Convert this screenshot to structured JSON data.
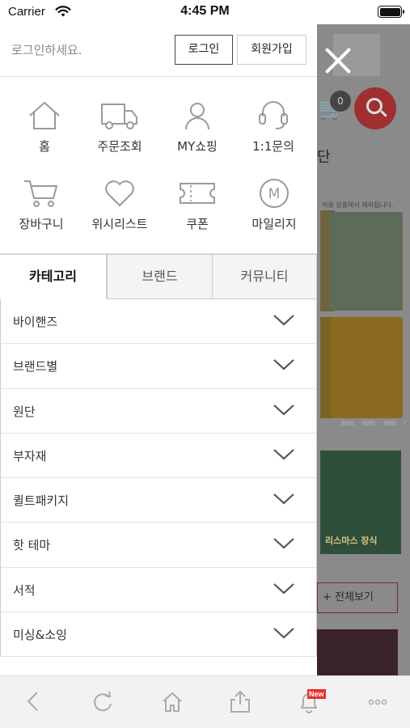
{
  "status_bar": {
    "carrier": "Carrier",
    "time": "4:45 PM"
  },
  "drawer": {
    "login_prompt": "로그인하세요.",
    "login_button": "로그인",
    "signup_button": "회원가입",
    "quick_links": [
      {
        "label": "홈",
        "icon": "home-icon"
      },
      {
        "label": "주문조회",
        "icon": "truck-icon"
      },
      {
        "label": "MY쇼핑",
        "icon": "person-icon"
      },
      {
        "label": "1:1문의",
        "icon": "headset-icon"
      },
      {
        "label": "장바구니",
        "icon": "cart-icon"
      },
      {
        "label": "위시리스트",
        "icon": "heart-icon"
      },
      {
        "label": "쿠폰",
        "icon": "coupon-icon"
      },
      {
        "label": "마일리지",
        "icon": "mileage-icon"
      }
    ],
    "mileage_icon_letter": "M",
    "tabs": [
      {
        "label": "카테고리",
        "active": true
      },
      {
        "label": "브랜드",
        "active": false
      },
      {
        "label": "커뮤니티",
        "active": false
      }
    ],
    "categories": [
      "바이핸즈",
      "브랜드별",
      "원단",
      "부자재",
      "퀼트패키지",
      "핫 테마",
      "서적",
      "미싱&소잉"
    ]
  },
  "background_page": {
    "cart_count": "0",
    "title_fragment": "단",
    "notice_fragment": "적용 상품에서 제외됩니다.",
    "xmas_label": "리스마스 장식",
    "view_all_button": "+ 전체보기"
  },
  "toolbar": {
    "items": [
      "back-icon",
      "refresh-icon",
      "home-icon",
      "share-icon",
      "bell-icon",
      "more-icon"
    ],
    "new_badge": "New"
  },
  "colors": {
    "accent_red": "#e5322d",
    "icon_gray": "#9a9a9a",
    "text": "#333333"
  }
}
